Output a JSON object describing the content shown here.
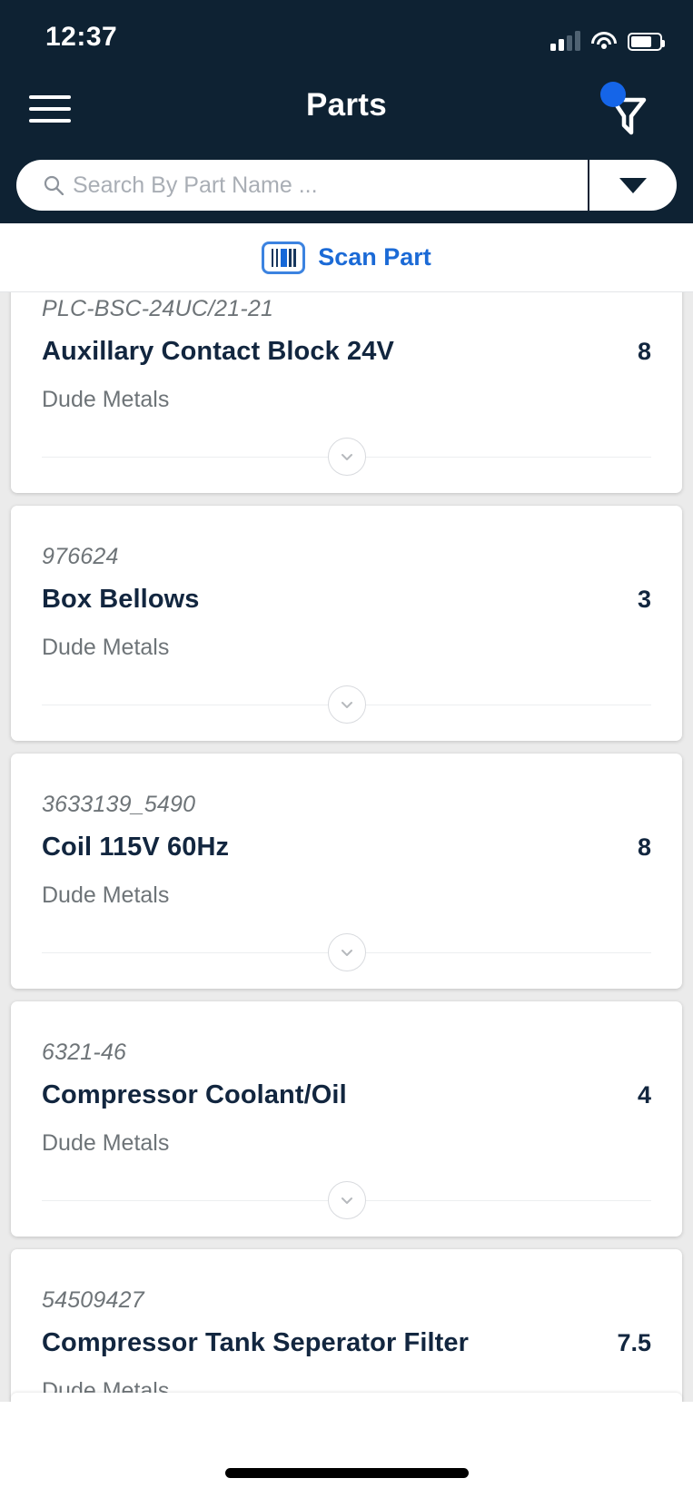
{
  "status_bar": {
    "time": "12:37",
    "signal_icon": "cellular-signal-icon",
    "wifi_icon": "wifi-icon",
    "battery_icon": "battery-icon"
  },
  "header": {
    "menu_icon": "hamburger-menu-icon",
    "title": "Parts",
    "filter_icon": "filter-funnel-icon",
    "filter_badge": "",
    "accent_blue": "#1565e8",
    "background": "#0e2233"
  },
  "search": {
    "icon": "search-icon",
    "placeholder": "Search By Part Name ...",
    "value": "",
    "dropdown_icon": "chevron-down-icon"
  },
  "scan": {
    "icon": "barcode-icon",
    "label": "Scan Part",
    "color": "#1b6ad6"
  },
  "parts": [
    {
      "sku": "PLC-BSC-24UC/21-21",
      "name": "Auxillary Contact Block 24V",
      "quantity": "8",
      "supplier": "Dude Metals",
      "expand_icon": "chevron-down-circle-icon"
    },
    {
      "sku": "976624",
      "name": "Box Bellows",
      "quantity": "3",
      "supplier": "Dude Metals",
      "expand_icon": "chevron-down-circle-icon"
    },
    {
      "sku": "3633139_5490",
      "name": "Coil 115V 60Hz",
      "quantity": "8",
      "supplier": "Dude Metals",
      "expand_icon": "chevron-down-circle-icon"
    },
    {
      "sku": "6321-46",
      "name": "Compressor Coolant/Oil",
      "quantity": "4",
      "supplier": "Dude Metals",
      "expand_icon": "chevron-down-circle-icon"
    },
    {
      "sku": "54509427",
      "name": "Compressor Tank Seperator Filter",
      "quantity": "7.5",
      "supplier": "Dude Metals",
      "expand_icon": "chevron-down-circle-icon"
    }
  ],
  "home_indicator": "home-indicator"
}
